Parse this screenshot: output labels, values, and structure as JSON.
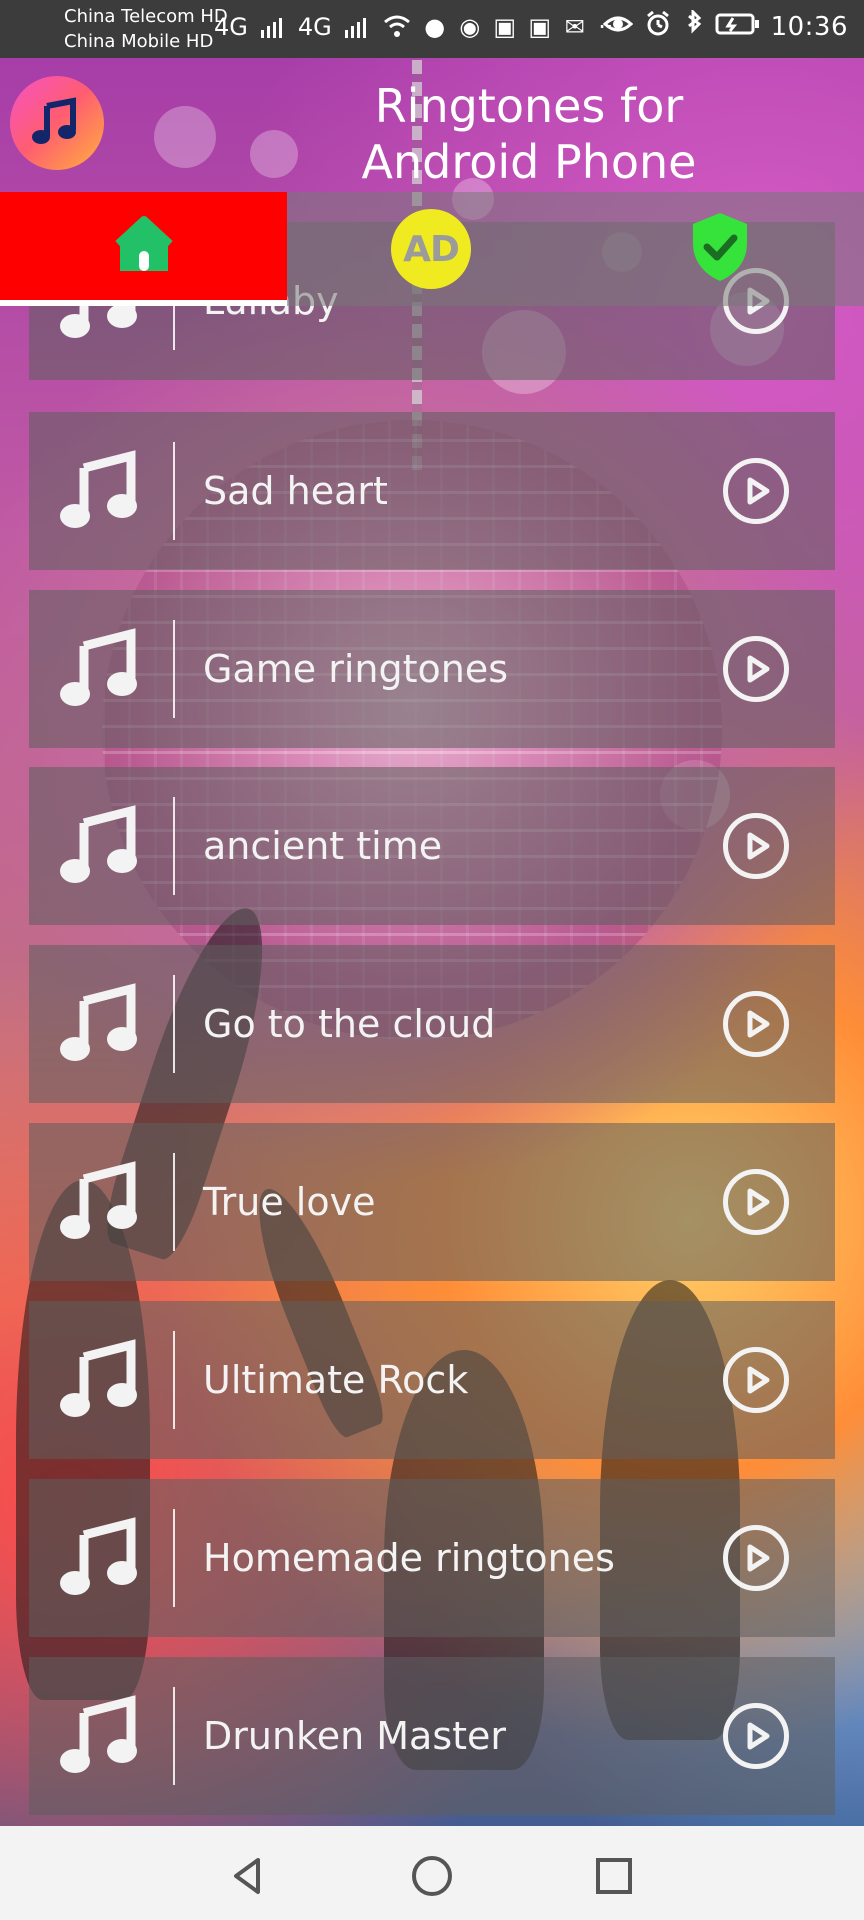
{
  "status_bar": {
    "carrier_1": "China Telecom HD",
    "carrier_2": "China Mobile HD",
    "network_1": "4G",
    "network_2": "4G",
    "more": "···",
    "time": "10:36"
  },
  "app": {
    "title": "Ringtones for Android Phone",
    "logo_icon": "music-note-icon"
  },
  "tabs": [
    {
      "icon": "home-icon",
      "selected": true,
      "color": "#ff0000"
    },
    {
      "icon": "ad-icon",
      "label": "AD",
      "color": "#f0eb20"
    },
    {
      "icon": "shield-check-icon",
      "color": "#35e33a"
    }
  ],
  "ringtones": [
    {
      "label": "Lullaby",
      "icon": "music-note-icon",
      "action_icon": "play-icon"
    },
    {
      "label": "Sad heart",
      "icon": "music-note-icon",
      "action_icon": "play-icon"
    },
    {
      "label": "Game ringtones",
      "icon": "music-note-icon",
      "action_icon": "play-icon"
    },
    {
      "label": "ancient time",
      "icon": "music-note-icon",
      "action_icon": "play-icon"
    },
    {
      "label": "Go to the cloud",
      "icon": "music-note-icon",
      "action_icon": "play-icon"
    },
    {
      "label": "True love",
      "icon": "music-note-icon",
      "action_icon": "play-icon"
    },
    {
      "label": "Ultimate Rock",
      "icon": "music-note-icon",
      "action_icon": "play-icon"
    },
    {
      "label": "Homemade ringtones",
      "icon": "music-note-icon",
      "action_icon": "play-icon"
    },
    {
      "label": "Drunken Master",
      "icon": "music-note-icon",
      "action_icon": "play-icon"
    }
  ],
  "navigation": [
    {
      "icon": "back-icon"
    },
    {
      "icon": "home-circle-icon"
    },
    {
      "icon": "recent-apps-icon"
    }
  ]
}
